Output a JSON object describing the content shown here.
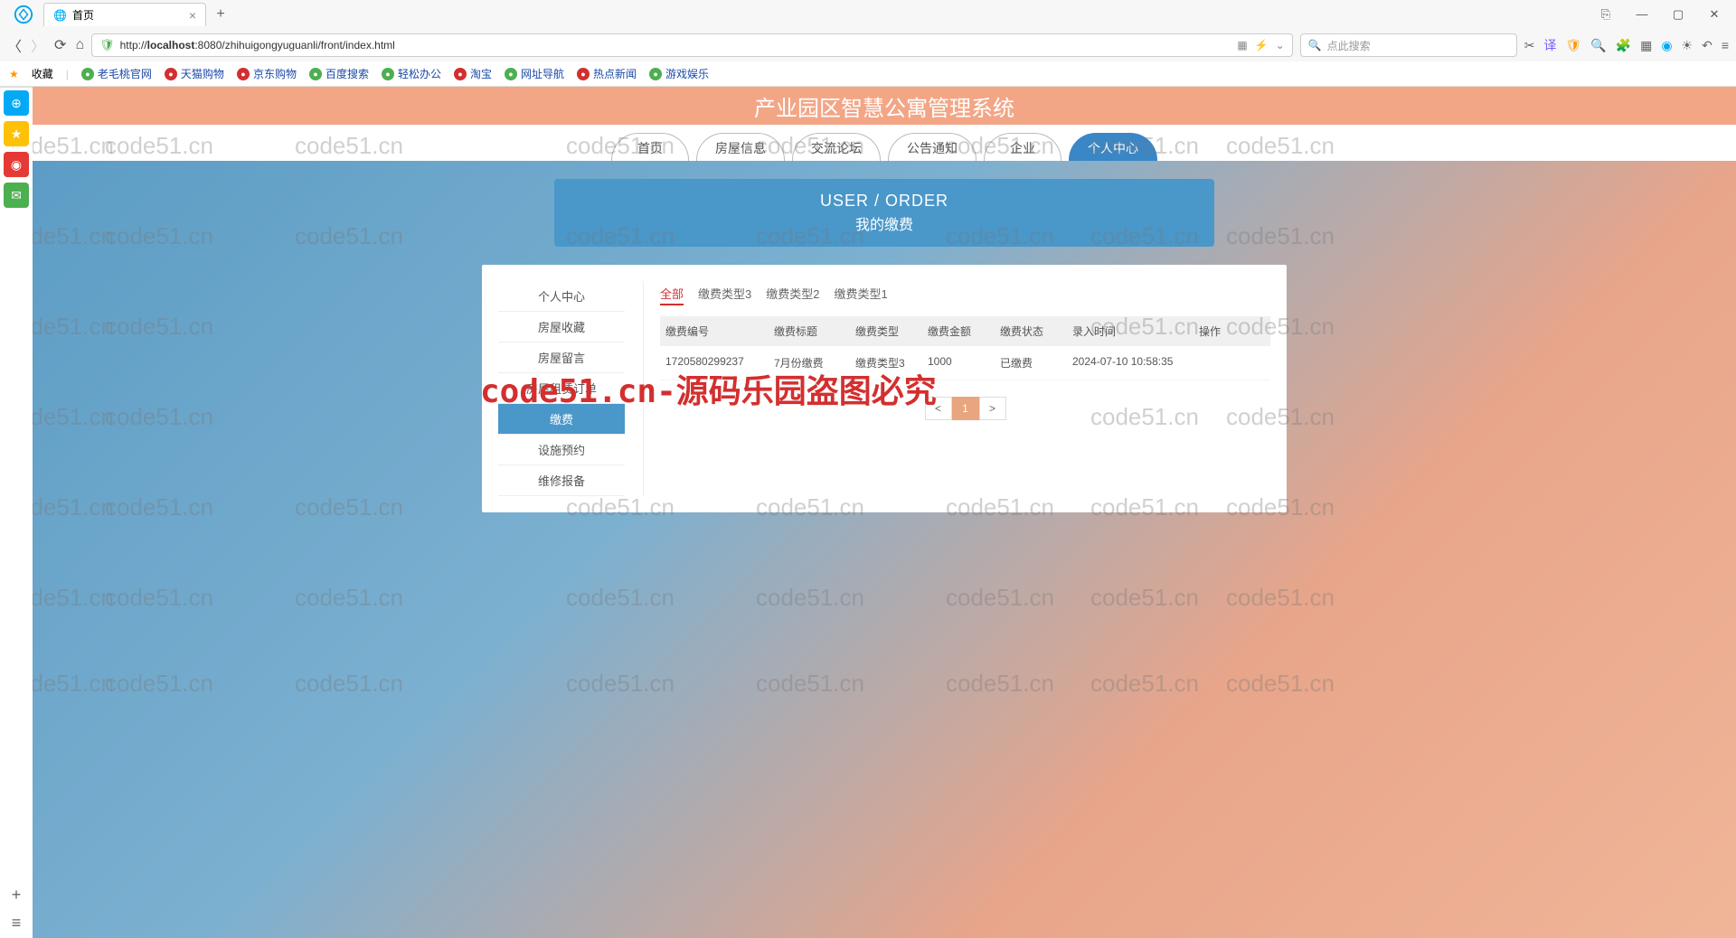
{
  "browser": {
    "tab_title": "首页",
    "url_prefix": "http://",
    "url_host": "localhost",
    "url_port_path": ":8080/zhihuigongyuguanli/front/index.html",
    "search_placeholder": "点此搜索",
    "bookmarks": {
      "fav_label": "收藏",
      "items": [
        "老毛桃官网",
        "天猫购物",
        "京东购物",
        "百度搜索",
        "轻松办公",
        "淘宝",
        "网址导航",
        "热点新闻",
        "游戏娱乐"
      ]
    }
  },
  "app": {
    "title": "产业园区智慧公寓管理系统",
    "nav": [
      "首页",
      "房屋信息",
      "交流论坛",
      "公告通知",
      "企业",
      "个人中心"
    ],
    "nav_active_index": 5,
    "section": {
      "en": "USER / ORDER",
      "zh": "我的缴费"
    },
    "side_menu": [
      "个人中心",
      "房屋收藏",
      "房屋留言",
      "房屋租赁订单",
      "缴费",
      "设施预约",
      "维修报备"
    ],
    "side_menu_active_index": 4,
    "filters": [
      "全部",
      "缴费类型3",
      "缴费类型2",
      "缴费类型1"
    ],
    "filters_active_index": 0,
    "table": {
      "headers": [
        "缴费编号",
        "缴费标题",
        "缴费类型",
        "缴费金额",
        "缴费状态",
        "录入时间",
        "操作"
      ],
      "rows": [
        {
          "id": "1720580299237",
          "title": "7月份缴费",
          "type": "缴费类型3",
          "amount": "1000",
          "status": "已缴费",
          "time": "2024-07-10 10:58:35",
          "action": ""
        }
      ]
    },
    "pagination": {
      "prev": "<",
      "page": "1",
      "next": ">"
    }
  },
  "watermark": {
    "text": "code51.cn",
    "red_text": "code51.cn-源码乐园盗图必究"
  }
}
